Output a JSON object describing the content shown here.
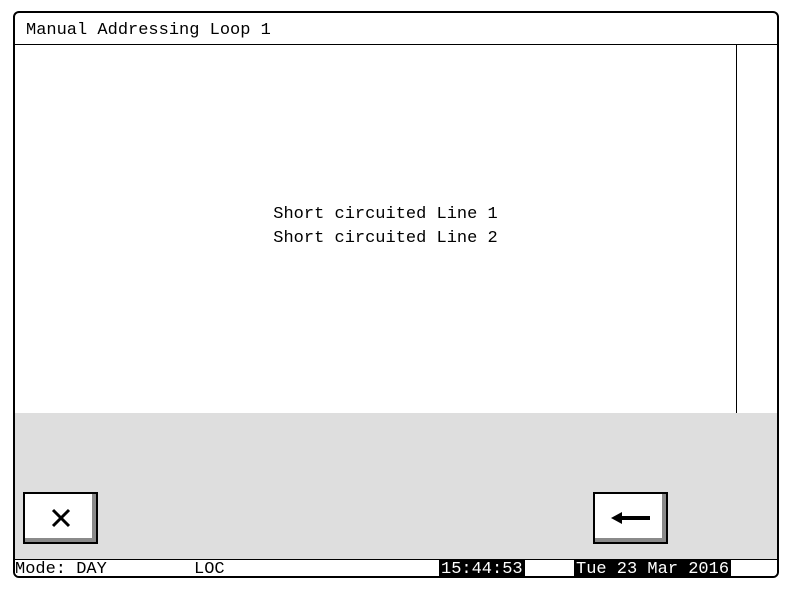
{
  "window": {
    "title": "Manual Addressing Loop 1"
  },
  "messages": [
    "Short circuited Line 1",
    "Short circuited Line 2"
  ],
  "buttons": {
    "cancel_icon": "close-x-icon",
    "back_icon": "arrow-left-icon"
  },
  "status": {
    "mode": "Mode: DAY",
    "location": "LOC",
    "time": "15:44:53",
    "date": "Tue 23 Mar 2016"
  },
  "colors": {
    "panel_background": "#dedede",
    "status_highlight_bg": "#000000",
    "status_highlight_fg": "#ffffff"
  }
}
